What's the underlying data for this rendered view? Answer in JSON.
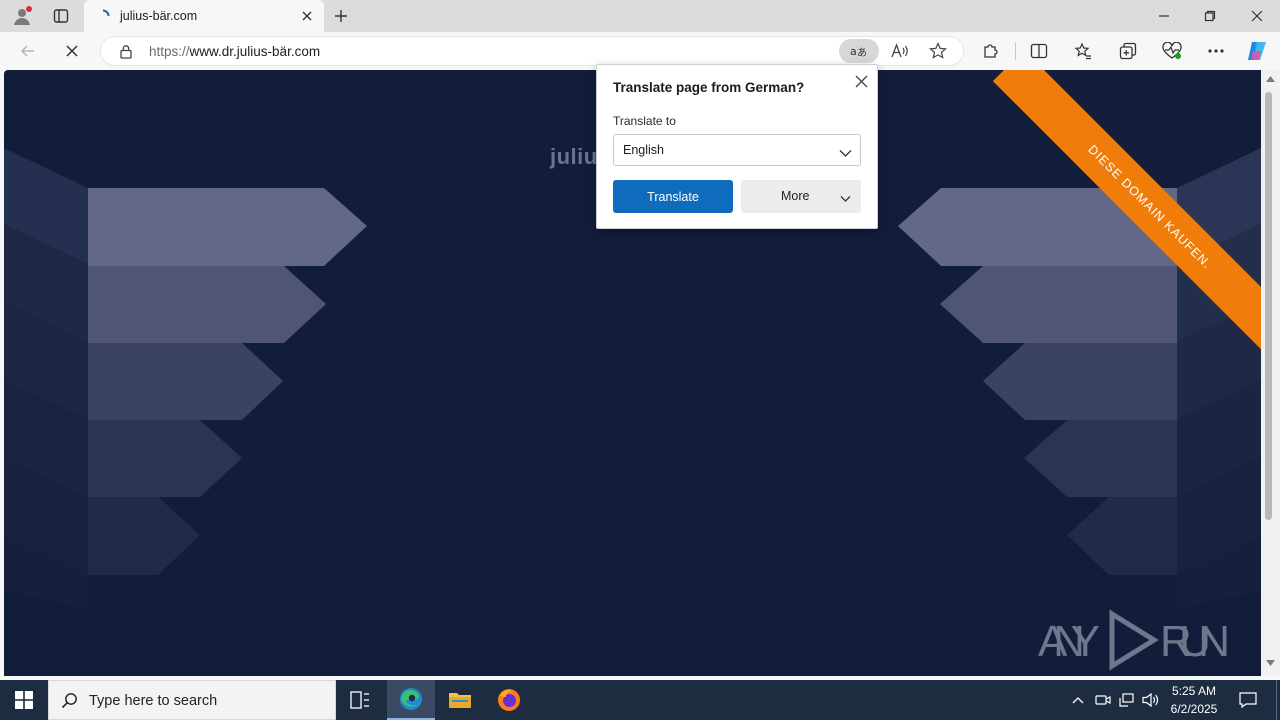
{
  "browser": {
    "tab_title": "julius-bär.com",
    "url_scheme": "https://",
    "url_host": "www.dr.julius-bär.com"
  },
  "page": {
    "site_title": "juliu",
    "banner_text": "DIESE DOMAIN KAUFEN.",
    "watermark": "ANY RUN"
  },
  "translate_popup": {
    "title": "Translate page from German?",
    "translate_to_label": "Translate to",
    "selected_language": "English",
    "translate_button": "Translate",
    "more_button": "More"
  },
  "taskbar": {
    "search_placeholder": "Type here to search",
    "time": "5:25 AM",
    "date": "6/2/2025"
  },
  "colors": {
    "page_bg": "#111d3b",
    "banner": "#f07d0a",
    "accent": "#0f6cbd",
    "taskbar": "#1e2c42"
  }
}
